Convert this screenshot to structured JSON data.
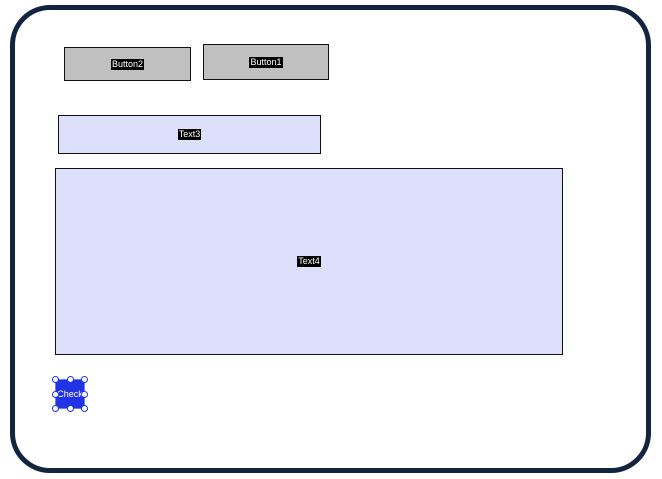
{
  "widgets": {
    "button2": {
      "label": "Button2"
    },
    "button1": {
      "label": "Button1"
    },
    "text3": {
      "label": "Text3"
    },
    "text4": {
      "label": "Text4"
    },
    "check": {
      "label": "Check"
    }
  },
  "colors": {
    "frame_border": "#13243f",
    "button_fill": "#c0c0c0",
    "textbox_fill": "#dde0fb",
    "selection_blue": "#2233e6",
    "label_background": "#000000"
  }
}
